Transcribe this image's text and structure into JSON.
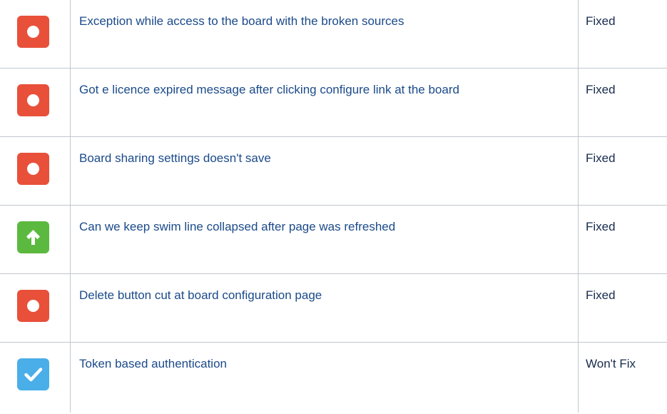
{
  "colors": {
    "bug": "#e8503a",
    "improvement": "#5cb93f",
    "task": "#4aaee8",
    "link": "#1b4a8a",
    "status_text": "#172b4d",
    "border": "#c1c7d0"
  },
  "issues": [
    {
      "type_icon": "bug-icon",
      "summary": "Exception while access to the board with the broken sources",
      "status": "Fixed"
    },
    {
      "type_icon": "bug-icon",
      "summary": "Got e licence expired message after clicking configure link at the board",
      "status": "Fixed"
    },
    {
      "type_icon": "bug-icon",
      "summary": "Board sharing settings doesn't save",
      "status": "Fixed"
    },
    {
      "type_icon": "improvement-icon",
      "summary": "Can we keep swim line collapsed after page was refreshed",
      "status": "Fixed"
    },
    {
      "type_icon": "bug-icon",
      "summary": "Delete button cut at board configuration page",
      "status": "Fixed"
    },
    {
      "type_icon": "task-icon",
      "summary": "Token based authentication",
      "status": "Won't Fix"
    }
  ]
}
